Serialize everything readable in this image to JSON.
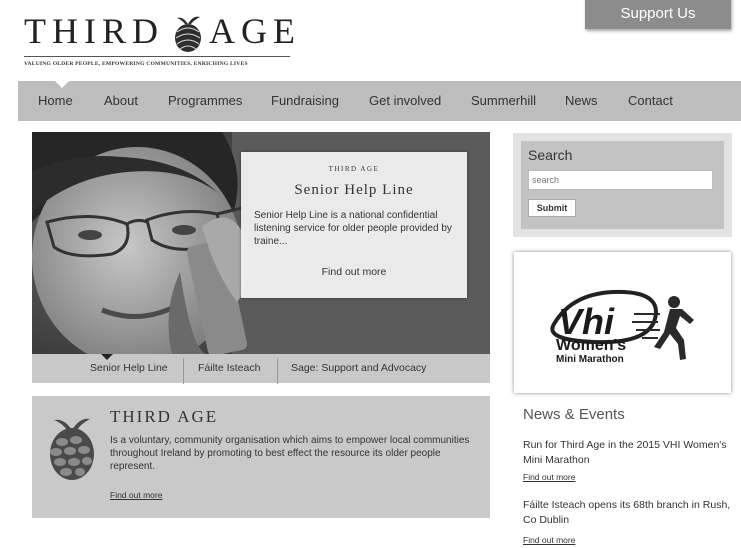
{
  "header": {
    "logo_word1": "THIRD",
    "logo_word2": "AGE",
    "tagline": "Valuing older people, empowering communities, enriching lives",
    "support_label": "Support Us"
  },
  "nav": {
    "items": [
      "Home",
      "About",
      "Programmes",
      "Fundraising",
      "Get involved",
      "Summerhill",
      "News",
      "Contact"
    ],
    "active": "Home"
  },
  "hero": {
    "card_brand": "THIRD AGE",
    "card_title": "Senior Help Line",
    "card_body": "Senior Help Line is a national confidential listening service for older people provided by traine...",
    "card_link": "Find out more",
    "tabs": [
      "Senior Help Line",
      "Fáilte Isteach",
      "Sage: Support and Advocacy"
    ],
    "active_tab": "Senior Help Line"
  },
  "about": {
    "title": "THIRD AGE",
    "body": "Is a voluntary, community organisation which aims to empower local communities throughout Ireland by promoting to best effect the resource its older people represent.",
    "link": "Find out more"
  },
  "search": {
    "title": "Search",
    "placeholder": "search",
    "button": "Submit"
  },
  "sponsor": {
    "brand": "Vhi",
    "line1": "Women's",
    "line2": "Mini Marathon"
  },
  "news": {
    "title": "News & Events",
    "items": [
      {
        "text": "Run for Third Age in the 2015 VHI Women's Mini Marathon",
        "link": "Find out more"
      },
      {
        "text": "Fáilte Isteach opens its 68th branch in Rush, Co Dublin",
        "link": "Find out more"
      }
    ]
  },
  "colors": {
    "nav_bg": "#bdbdbd",
    "support_bg": "#8c8c8c",
    "panel_bg": "#c9c9c9"
  }
}
